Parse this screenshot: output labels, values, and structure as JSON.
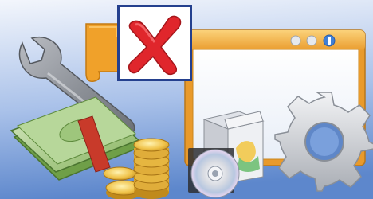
{
  "scene": {
    "background_gradient": [
      "#eef3fb",
      "#6f97d6"
    ],
    "icons": [
      "wrench-icon",
      "puzzle-piece-icon",
      "close-icon",
      "window-icon",
      "software-box-icon",
      "disc-icon",
      "gear-icon",
      "cash-bundle-icon",
      "gold-coins-icon"
    ]
  },
  "colors": {
    "close_mark": "#e0262c",
    "close_frame": "#24408e",
    "window_frame": "#efa435",
    "banknote": "#8fbf6b",
    "money_band": "#c83a2a",
    "coin": "#f0c34a",
    "gear": "#d6d9de"
  }
}
